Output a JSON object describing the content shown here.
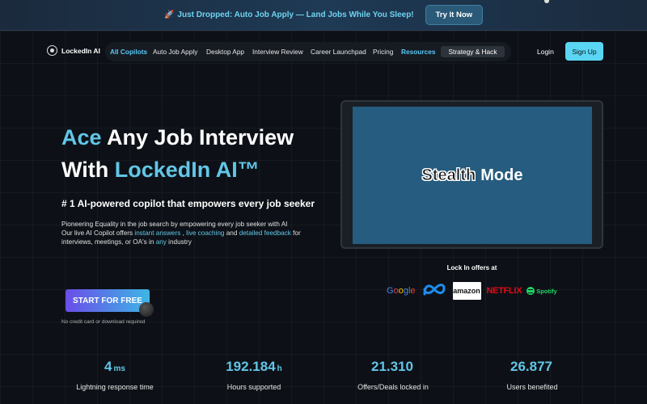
{
  "banner": {
    "text": "Just Dropped: Auto Job Apply — Land Jobs While You Sleep!",
    "icon": "rocket-icon",
    "button": "Try It Now"
  },
  "nav": {
    "brand": "LockedIn AI",
    "items": [
      "All Copilots",
      "Auto Job Apply",
      "Desktop App",
      "Interview Review",
      "Career Launchpad",
      "Pricing",
      "Resources"
    ],
    "tag": "Strategy & Hack",
    "login": "Login",
    "signup": "Sign Up"
  },
  "hero": {
    "title_accent_1": "Ace",
    "title_plain_1": " Any Job Interview",
    "title_plain_2": "With ",
    "title_accent_2": "LockedIn AI™",
    "tagline_pre": "# 1 AI-powered copilot that ",
    "tagline_bold": "empowers",
    "tagline_post": " every job seeker",
    "desc_line1": "Pioneering Equality in the job search by empowering every job seeker with AI",
    "desc_pre": "Our live AI Copilot offers ",
    "desc_hl1": "instant answers",
    "desc_sep1": " , ",
    "desc_hl2": "live coaching",
    "desc_sep2": " and ",
    "desc_hl3": "detailed feedback",
    "desc_mid": " for interviews, meetings, or OA's in ",
    "desc_hl4": "any",
    "desc_end": " industry",
    "cta": "START FOR FREE",
    "cta_note": "No credit card or download required"
  },
  "video": {
    "word1": "Stealth",
    "word2": "Mode"
  },
  "offers": {
    "label": "Lock In offers at",
    "logos": [
      "Google",
      "Meta",
      "amazon",
      "NETFLIX",
      "Spotify"
    ]
  },
  "stats": [
    {
      "value": "4",
      "unit": "ms",
      "label": "Lightning response time"
    },
    {
      "value": "192.184",
      "unit": "h",
      "label": "Hours supported"
    },
    {
      "value": "21.310",
      "unit": "",
      "label": "Offers/Deals locked in"
    },
    {
      "value": "26.877",
      "unit": "",
      "label": "Users benefited"
    }
  ],
  "colors": {
    "accent": "#62c6e6",
    "signup": "#5ad6f2",
    "background": "#0d1117"
  }
}
